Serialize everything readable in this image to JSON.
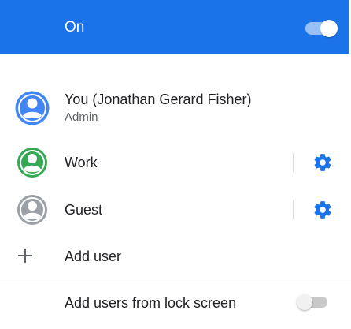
{
  "header": {
    "label": "On",
    "switch_state": "on",
    "color": "#1a73e8"
  },
  "users": [
    {
      "name": "You (Jonathan Gerard Fisher)",
      "role": "Admin",
      "avatar_color": "#4285f4",
      "icon": "person-avatar-icon"
    },
    {
      "name": "Work",
      "avatar_color": "#34a853",
      "icon": "person-avatar-icon",
      "action_icon": "gear-icon"
    },
    {
      "name": "Guest",
      "avatar_color": "#9aa0a6",
      "icon": "person-avatar-icon",
      "action_icon": "gear-icon"
    }
  ],
  "add_user": {
    "label": "Add user",
    "icon": "plus-icon"
  },
  "lock_screen": {
    "label": "Add users from lock screen",
    "switch_state": "off"
  },
  "accent_color": "#1a73e8"
}
